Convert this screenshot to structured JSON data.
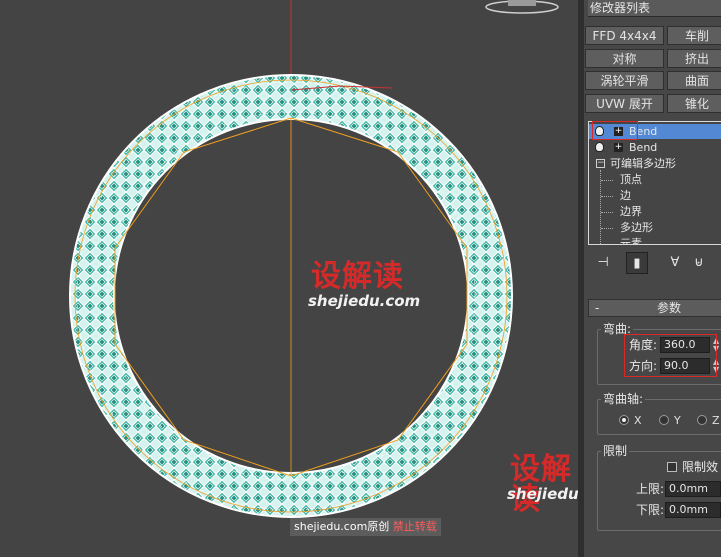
{
  "watermark": {
    "site_cn": "设解读",
    "site_en": "shejiedu.com",
    "credit_prefix": "shejiedu.com原创",
    "credit_warning": "禁止转载"
  },
  "panel": {
    "modifier_list": "修改器列表",
    "buttons": [
      "FFD 4x4x4",
      "车削",
      "对称",
      "挤出",
      "涡轮平滑",
      "曲面",
      "UVW 展开",
      "锥化"
    ],
    "stack": {
      "items": [
        "Bend",
        "Bend"
      ],
      "editable_poly": "可编辑多边形",
      "subobjects": [
        "顶点",
        "边",
        "边界",
        "多边形",
        "元素"
      ]
    },
    "tool_icons": [
      "pin-stack-icon",
      "show-end-result-icon",
      "make-unique-icon",
      "remove-modifier-icon"
    ],
    "rollout": {
      "collapse_sign": "-",
      "title": "参数",
      "bend_group": "弯曲:",
      "angle_label": "角度:",
      "angle_value": "360.0",
      "direction_label": "方向:",
      "direction_value": "90.0",
      "axis_group": "弯曲轴:",
      "axis_x": "X",
      "axis_y": "Y",
      "axis_z": "Z",
      "limits_group": "限制",
      "limit_effect": "限制效",
      "upper_label": "上限:",
      "upper_value": "0.0mm",
      "lower_label": "下限:",
      "lower_value": "0.0mm"
    }
  },
  "colors": {
    "ring_fill": "#3fb8a6",
    "ring_wire": "#ffffff",
    "gizmo": "#f0a020",
    "axis_red": "#c83232",
    "selection": "#5288d4",
    "highlight": "#d82828"
  }
}
